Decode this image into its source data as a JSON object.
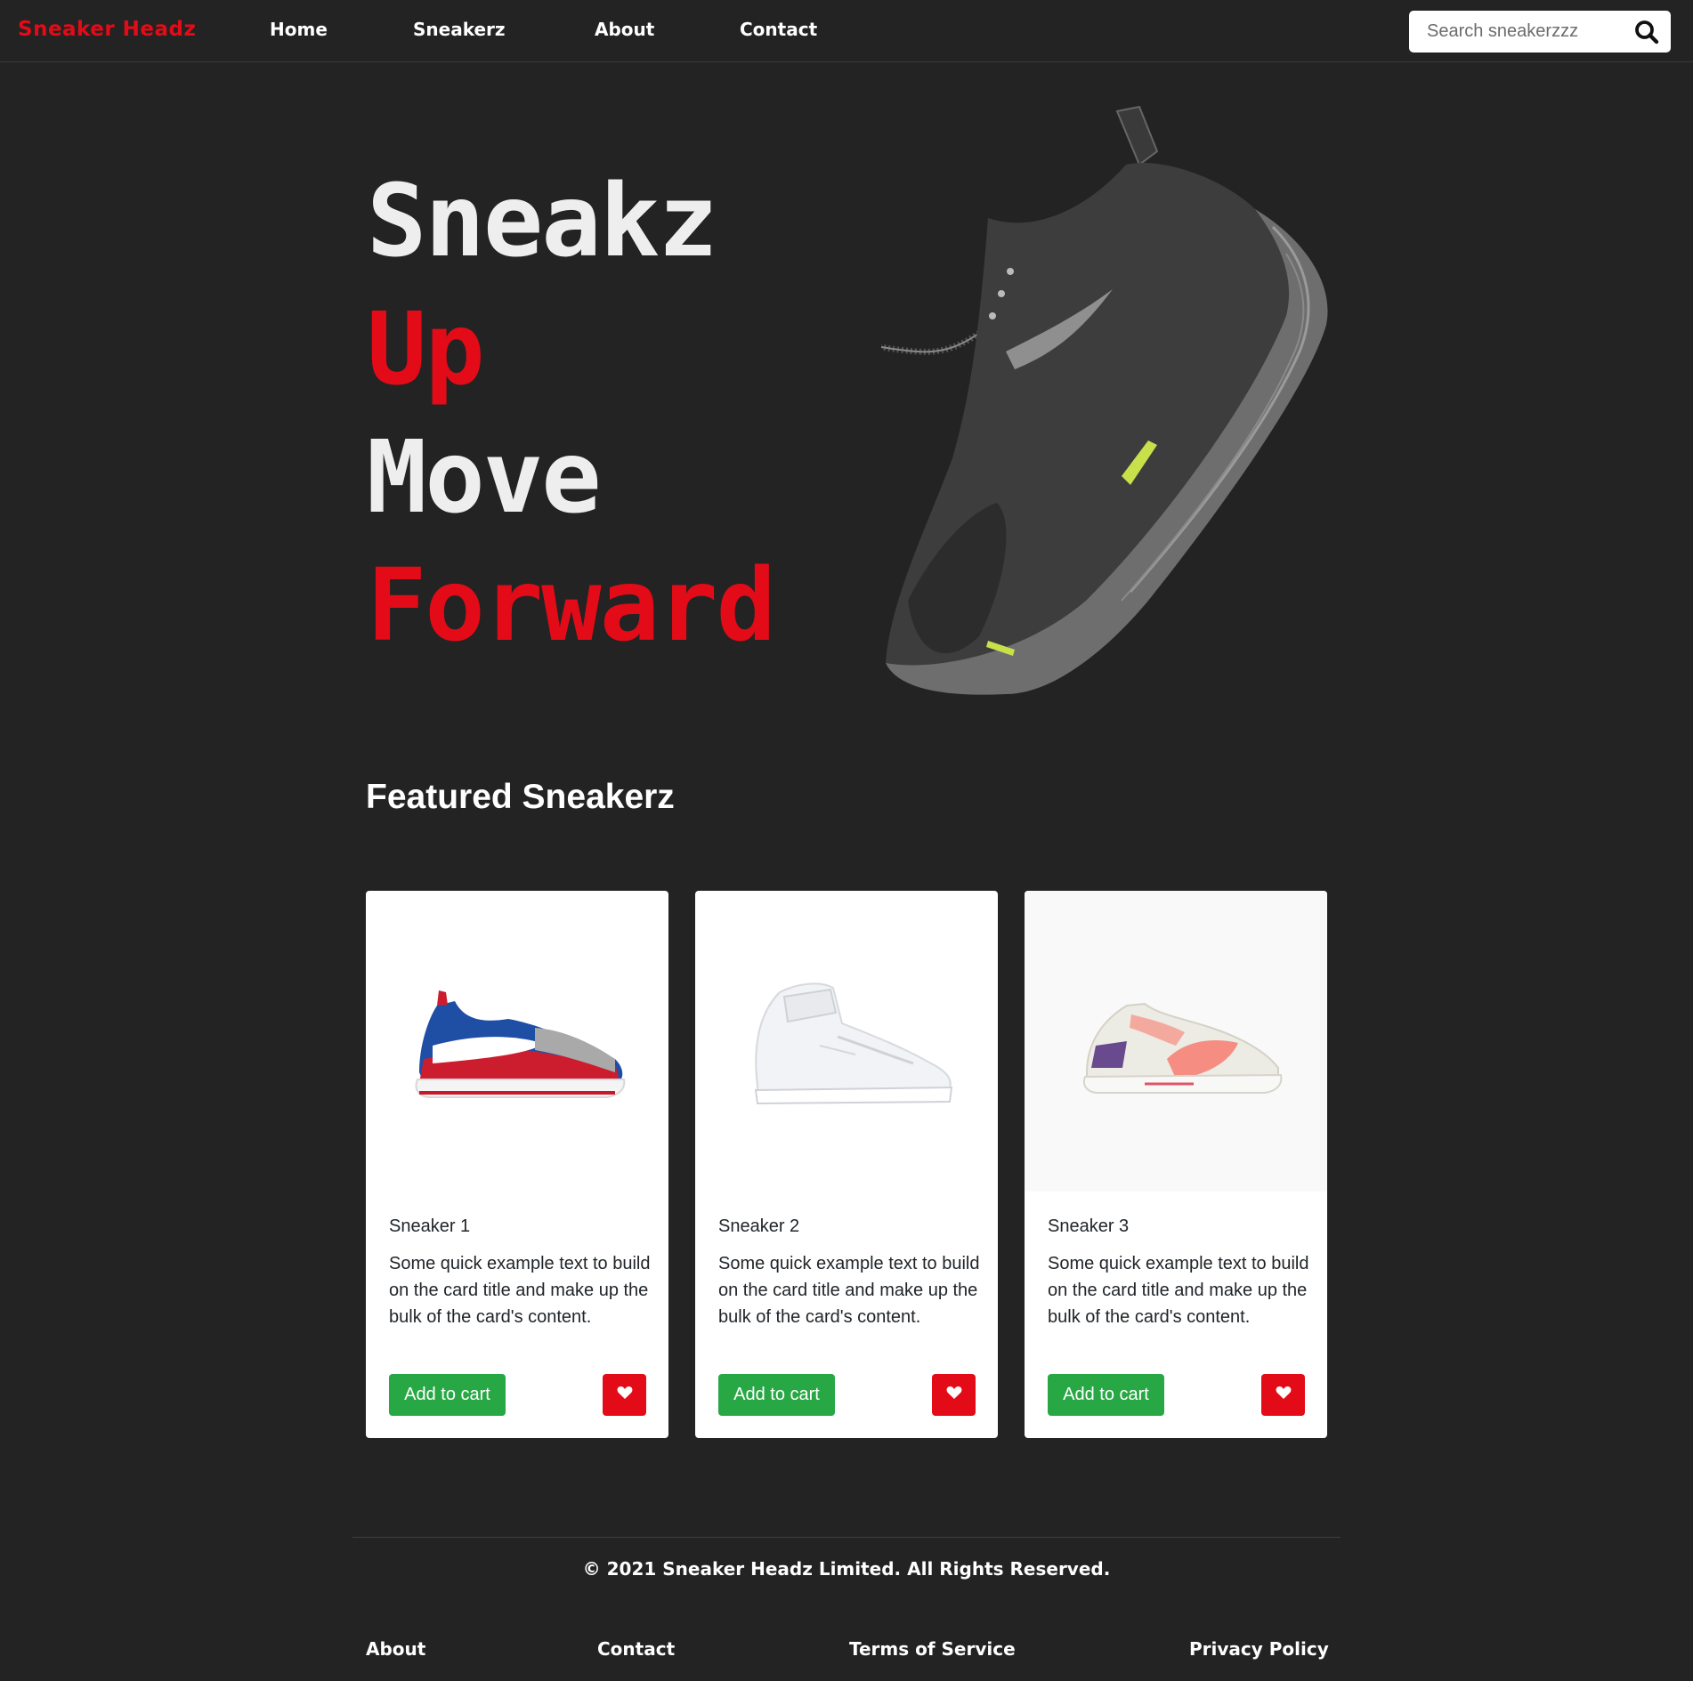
{
  "nav": {
    "brand": "Sneaker Headz",
    "links": [
      "Home",
      "Sneakerz",
      "About",
      "Contact"
    ],
    "search_placeholder": "Search sneakerzzz",
    "search_icon": "search-icon"
  },
  "hero": {
    "words": [
      "Sneakz",
      "Up",
      "Move",
      "Forward"
    ]
  },
  "featured": {
    "title": "Featured Sneakerz",
    "cards": [
      {
        "title": "Sneaker 1",
        "text": "Some quick example text to build on the card title and make up the bulk of the card's content.",
        "cart_label": "Add to cart",
        "fav_icon": "heart-icon"
      },
      {
        "title": "Sneaker 2",
        "text": "Some quick example text to build on the card title and make up the bulk of the card's content.",
        "cart_label": "Add to cart",
        "fav_icon": "heart-icon"
      },
      {
        "title": "Sneaker 3",
        "text": "Some quick example text to build on the card title and make up the bulk of the card's content.",
        "cart_label": "Add to cart",
        "fav_icon": "heart-icon"
      }
    ]
  },
  "footer": {
    "copyright": "© 2021 Sneaker Headz Limited. All Rights Reserved.",
    "links": [
      "About",
      "Contact",
      "Terms of Service",
      "Privacy Policy"
    ]
  },
  "colors": {
    "background": "#232323",
    "accent_red": "#e30b17",
    "cart_green": "#28a745",
    "text_white": "#ffffff"
  }
}
